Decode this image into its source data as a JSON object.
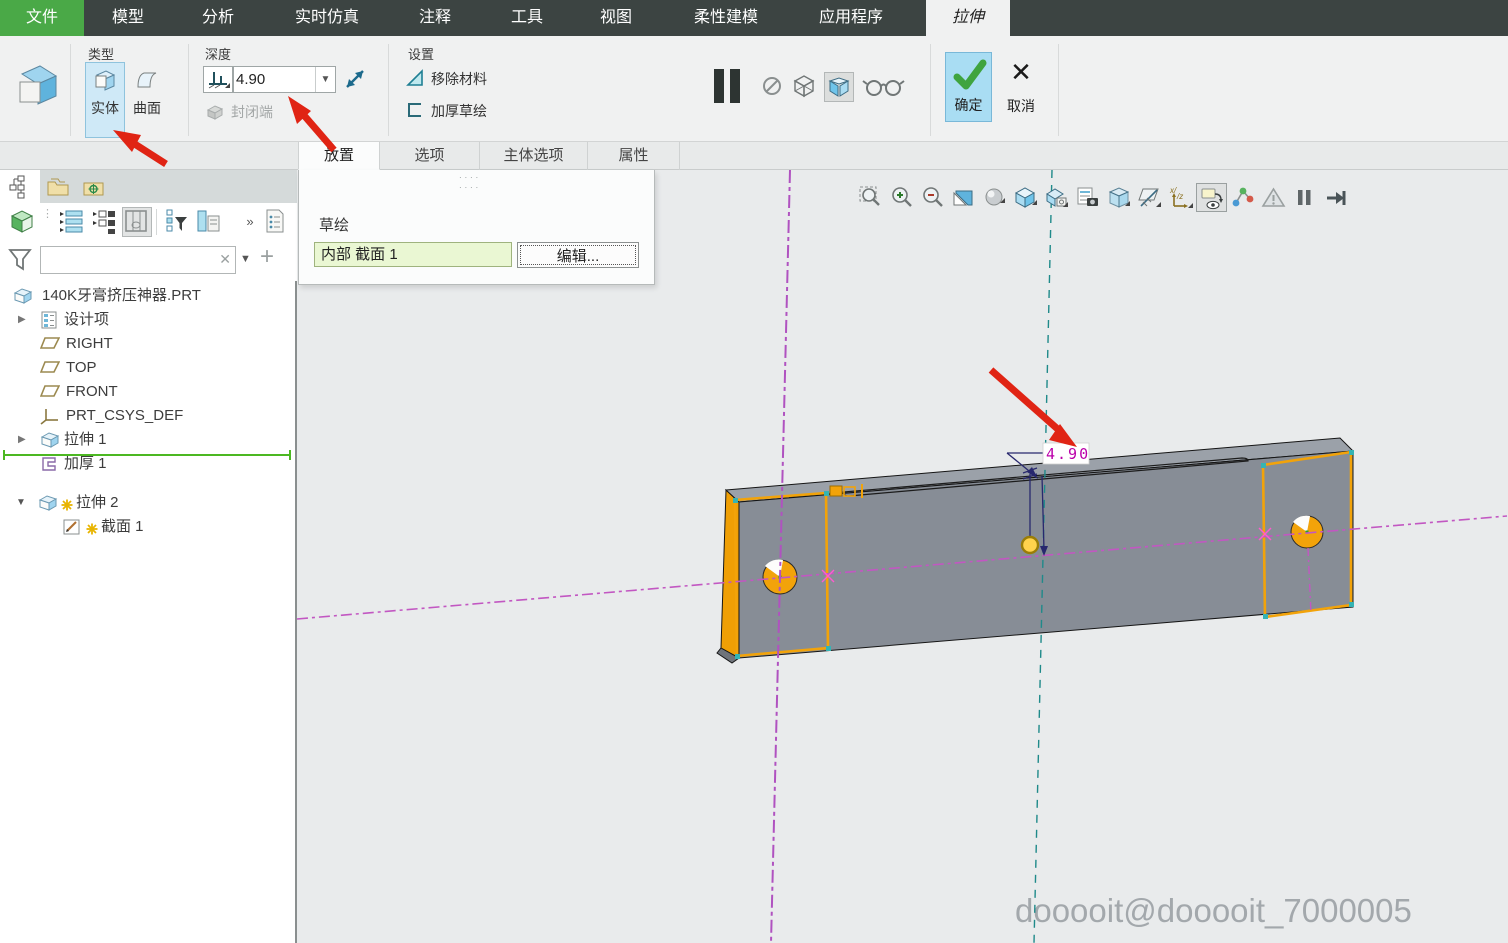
{
  "ribbon": {
    "tabs": [
      {
        "label": "文件"
      },
      {
        "label": "模型"
      },
      {
        "label": "分析"
      },
      {
        "label": "实时仿真"
      },
      {
        "label": "注释"
      },
      {
        "label": "工具"
      },
      {
        "label": "视图"
      },
      {
        "label": "柔性建模"
      },
      {
        "label": "应用程序"
      },
      {
        "label": "拉伸"
      }
    ],
    "active_tab": "拉伸"
  },
  "dashboard": {
    "type_group": {
      "label": "类型",
      "solid_label": "实体",
      "surface_label": "曲面",
      "selected": "实体"
    },
    "depth_group": {
      "label": "深度",
      "depth_value": "4.90",
      "capped_label": "封闭端"
    },
    "settings_group": {
      "label": "设置",
      "remove_material_label": "移除材料",
      "thicken_label": "加厚草绘"
    },
    "ok_label": "确定",
    "cancel_label": "取消"
  },
  "panel_tabs": {
    "placement": "放置",
    "options": "选项",
    "body_options": "主体选项",
    "properties": "属性",
    "active": "放置"
  },
  "placement_panel": {
    "sketch_label": "草绘",
    "sketch_ref": "内部 截面 1",
    "edit_label": "编辑..."
  },
  "model_tree": {
    "items": [
      {
        "label": "140K牙膏挤压神器.PRT",
        "icon": "part-icon"
      },
      {
        "label": "设计项",
        "icon": "design-items-icon",
        "expander": "collapsed"
      },
      {
        "label": "RIGHT",
        "icon": "datum-plane-icon"
      },
      {
        "label": "TOP",
        "icon": "datum-plane-icon"
      },
      {
        "label": "FRONT",
        "icon": "datum-plane-icon"
      },
      {
        "label": "PRT_CSYS_DEF",
        "icon": "csys-icon"
      },
      {
        "label": "拉伸 1",
        "icon": "extrude-icon",
        "expander": "collapsed"
      },
      {
        "label": "加厚 1",
        "icon": "thicken-icon"
      },
      {
        "label": "拉伸 2",
        "icon": "extrude-icon",
        "expander": "expanded",
        "pending": true
      },
      {
        "label": "截面 1",
        "icon": "sketch-icon",
        "pending": true
      }
    ]
  },
  "canvas": {
    "dimension_value": "4.90",
    "watermark": "dooooit@dooooit_7000005",
    "toolbar_icons": [
      "zoom-fit",
      "zoom-in",
      "zoom-out",
      "repaint",
      "shading-style",
      "display-style",
      "saved-orientations",
      "view-manager",
      "perspective",
      "datum-display",
      "annotation-orientation",
      "show-annotations",
      "graph-display",
      "simulate-warning",
      "pause",
      "exit-tool"
    ]
  },
  "colors": {
    "tab_green": "#4aa947",
    "selection_blue": "#cfe9f7",
    "ok_blue": "#a9ddf3",
    "highlight_orange": "#f2a30a",
    "axis_magenta": "#c257c2",
    "axis_cyan": "#1f8a8a",
    "dimension_magenta": "#bb00aa",
    "arrow_red": "#e02414",
    "part_gray": "#878d96"
  }
}
